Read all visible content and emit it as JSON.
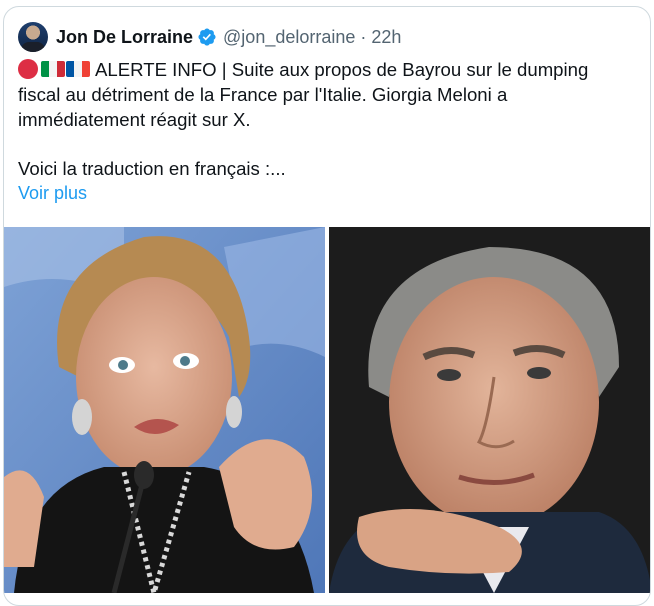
{
  "author": {
    "display_name": "Jon De Lorraine",
    "handle": "@jon_delorraine",
    "separator": "·",
    "time": "22h",
    "avatar_icon": "avatar-photo",
    "verified_icon": "verified-badge-icon",
    "verified_color": "#1d9bf0"
  },
  "tweet": {
    "flags": [
      "red-circle-icon",
      "italy-flag-icon",
      "france-flag-icon"
    ],
    "lines": [
      "ALERTE INFO | Suite aux propos de Bayrou sur le dumping",
      "fiscal au détriment de la France par l'Italie. Giorgia Meloni a",
      "immédiatement réagit sur X.",
      "",
      "Voici la traduction en français :..."
    ],
    "see_more": "Voir plus",
    "link_color": "#1d9bf0"
  },
  "media": {
    "left_photo": "photo-woman-speaking-at-microphone",
    "right_photo": "photo-man-portrait-hand-on-chin"
  }
}
